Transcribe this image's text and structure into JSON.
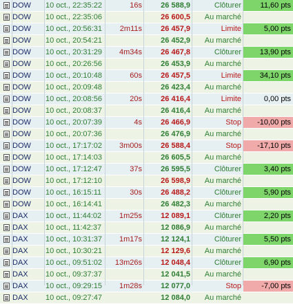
{
  "rows": [
    {
      "symbol": "DOW",
      "date": "10 oct., 22:35:22",
      "duration": "16s",
      "price": "26 588,9",
      "price_color": "green",
      "type": "Clôturer",
      "type_color": "green",
      "points": "11,60 pts",
      "points_color": "green"
    },
    {
      "symbol": "DOW",
      "date": "10 oct., 22:35:06",
      "duration": "",
      "price": "26 600,5",
      "price_color": "red",
      "type": "Au marché",
      "type_color": "green",
      "points": "",
      "points_color": "none"
    },
    {
      "symbol": "DOW",
      "date": "10 oct., 20:56:31",
      "duration": "2m11s",
      "price": "26 457,9",
      "price_color": "red",
      "type": "Limite",
      "type_color": "red",
      "points": "5,00 pts",
      "points_color": "green"
    },
    {
      "symbol": "DOW",
      "date": "10 oct., 20:54:21",
      "duration": "",
      "price": "26 452,9",
      "price_color": "green",
      "type": "Au marché",
      "type_color": "green",
      "points": "",
      "points_color": "none"
    },
    {
      "symbol": "DOW",
      "date": "10 oct., 20:31:29",
      "duration": "4m34s",
      "price": "26 467,8",
      "price_color": "red",
      "type": "Clôturer",
      "type_color": "green",
      "points": "13,90 pts",
      "points_color": "green"
    },
    {
      "symbol": "DOW",
      "date": "10 oct., 20:26:56",
      "duration": "",
      "price": "26 453,9",
      "price_color": "green",
      "type": "Au marché",
      "type_color": "green",
      "points": "",
      "points_color": "none"
    },
    {
      "symbol": "DOW",
      "date": "10 oct., 20:10:48",
      "duration": "60s",
      "price": "26 457,5",
      "price_color": "red",
      "type": "Limite",
      "type_color": "red",
      "points": "34,10 pts",
      "points_color": "green"
    },
    {
      "symbol": "DOW",
      "date": "10 oct., 20:09:48",
      "duration": "",
      "price": "26 423,4",
      "price_color": "green",
      "type": "Au marché",
      "type_color": "green",
      "points": "",
      "points_color": "none"
    },
    {
      "symbol": "DOW",
      "date": "10 oct., 20:08:56",
      "duration": "20s",
      "price": "26 416,4",
      "price_color": "red",
      "type": "Limite",
      "type_color": "red",
      "points": "0,00 pts",
      "points_color": "none"
    },
    {
      "symbol": "DOW",
      "date": "10 oct., 20:08:37",
      "duration": "",
      "price": "26 416,4",
      "price_color": "green",
      "type": "Au marché",
      "type_color": "green",
      "points": "",
      "points_color": "none"
    },
    {
      "symbol": "DOW",
      "date": "10 oct., 20:07:39",
      "duration": "4s",
      "price": "26 466,9",
      "price_color": "red",
      "type": "Stop",
      "type_color": "red",
      "points": "-10,00 pts",
      "points_color": "red"
    },
    {
      "symbol": "DOW",
      "date": "10 oct., 20:07:36",
      "duration": "",
      "price": "26 476,9",
      "price_color": "green",
      "type": "Au marché",
      "type_color": "green",
      "points": "",
      "points_color": "none"
    },
    {
      "symbol": "DOW",
      "date": "10 oct., 17:17:02",
      "duration": "3m00s",
      "price": "26 588,4",
      "price_color": "red",
      "type": "Stop",
      "type_color": "red",
      "points": "-17,10 pts",
      "points_color": "red"
    },
    {
      "symbol": "DOW",
      "date": "10 oct., 17:14:03",
      "duration": "",
      "price": "26 605,5",
      "price_color": "green",
      "type": "Au marché",
      "type_color": "green",
      "points": "",
      "points_color": "none"
    },
    {
      "symbol": "DOW",
      "date": "10 oct., 17:12:47",
      "duration": "37s",
      "price": "26 595,5",
      "price_color": "green",
      "type": "Clôturer",
      "type_color": "green",
      "points": "3,40 pts",
      "points_color": "green"
    },
    {
      "symbol": "DOW",
      "date": "10 oct., 17:12:10",
      "duration": "",
      "price": "26 598,9",
      "price_color": "red",
      "type": "Au marché",
      "type_color": "green",
      "points": "",
      "points_color": "none"
    },
    {
      "symbol": "DOW",
      "date": "10 oct., 16:15:11",
      "duration": "30s",
      "price": "26 488,2",
      "price_color": "red",
      "type": "Clôturer",
      "type_color": "green",
      "points": "5,90 pts",
      "points_color": "green"
    },
    {
      "symbol": "DOW",
      "date": "10 oct., 16:14:41",
      "duration": "",
      "price": "26 482,3",
      "price_color": "green",
      "type": "Au marché",
      "type_color": "green",
      "points": "",
      "points_color": "none"
    },
    {
      "symbol": "DAX",
      "date": "10 oct., 11:44:02",
      "duration": "1m25s",
      "price": "12 089,1",
      "price_color": "red",
      "type": "Clôturer",
      "type_color": "green",
      "points": "2,20 pts",
      "points_color": "green"
    },
    {
      "symbol": "DAX",
      "date": "10 oct., 11:42:37",
      "duration": "",
      "price": "12 086,9",
      "price_color": "green",
      "type": "Au marché",
      "type_color": "green",
      "points": "",
      "points_color": "none"
    },
    {
      "symbol": "DAX",
      "date": "10 oct., 10:31:37",
      "duration": "1m17s",
      "price": "12 124,1",
      "price_color": "green",
      "type": "Clôturer",
      "type_color": "green",
      "points": "5,50 pts",
      "points_color": "green"
    },
    {
      "symbol": "DAX",
      "date": "10 oct., 10:30:21",
      "duration": "",
      "price": "12 129,6",
      "price_color": "red",
      "type": "Au marché",
      "type_color": "green",
      "points": "",
      "points_color": "none"
    },
    {
      "symbol": "DAX",
      "date": "10 oct., 09:51:02",
      "duration": "13m26s",
      "price": "12 048,4",
      "price_color": "red",
      "type": "Clôturer",
      "type_color": "green",
      "points": "6,90 pts",
      "points_color": "green"
    },
    {
      "symbol": "DAX",
      "date": "10 oct., 09:37:37",
      "duration": "",
      "price": "12 041,5",
      "price_color": "green",
      "type": "Au marché",
      "type_color": "green",
      "points": "",
      "points_color": "none"
    },
    {
      "symbol": "DAX",
      "date": "10 oct., 09:29:15",
      "duration": "1m28s",
      "price": "12 077,0",
      "price_color": "green",
      "type": "Stop",
      "type_color": "red",
      "points": "-7,00 pts",
      "points_color": "red"
    },
    {
      "symbol": "DAX",
      "date": "10 oct., 09:27:47",
      "duration": "",
      "price": "12 084,0",
      "price_color": "green",
      "type": "Au marché",
      "type_color": "green",
      "points": "",
      "points_color": "none"
    }
  ],
  "icon": "document-icon"
}
